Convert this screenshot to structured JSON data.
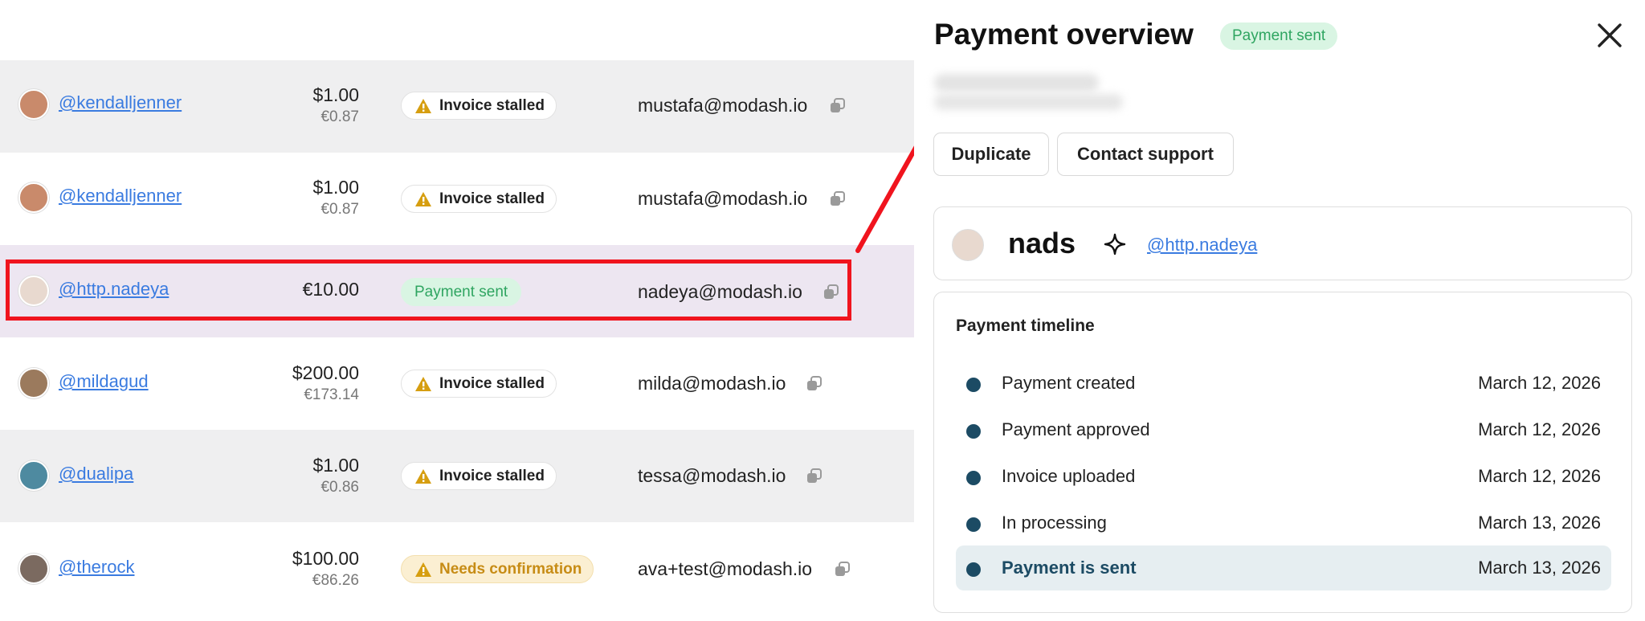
{
  "table": {
    "rows": [
      {
        "handle": "@kendalljenner",
        "amount": "$1.00",
        "amount_sub": "€0.87",
        "status": "Invoice stalled",
        "status_kind": "stalled",
        "email": "mustafa@modash.io",
        "avatar_color": "#c98a6b"
      },
      {
        "handle": "@kendalljenner",
        "amount": "$1.00",
        "amount_sub": "€0.87",
        "status": "Invoice stalled",
        "status_kind": "stalled",
        "email": "mustafa@modash.io",
        "avatar_color": "#c98a6b"
      },
      {
        "handle": "@http.nadeya",
        "amount": "€10.00",
        "amount_sub": "",
        "status": "Payment sent",
        "status_kind": "sent",
        "email": "nadeya@modash.io",
        "avatar_color": "#e8d9cf",
        "selected": true
      },
      {
        "handle": "@mildagud",
        "amount": "$200.00",
        "amount_sub": "€173.14",
        "status": "Invoice stalled",
        "status_kind": "stalled",
        "email": "milda@modash.io",
        "avatar_color": "#9b7a5d"
      },
      {
        "handle": "@dualipa",
        "amount": "$1.00",
        "amount_sub": "€0.86",
        "status": "Invoice stalled",
        "status_kind": "stalled",
        "email": "tessa@modash.io",
        "avatar_color": "#4e8aa0"
      },
      {
        "handle": "@therock",
        "amount": "$100.00",
        "amount_sub": "€86.26",
        "status": "Needs confirmation",
        "status_kind": "confirm",
        "email": "ava+test@modash.io",
        "avatar_color": "#7b6a60"
      }
    ]
  },
  "panel": {
    "title": "Payment overview",
    "badge": "Payment sent",
    "buttons": {
      "duplicate": "Duplicate",
      "support": "Contact support"
    },
    "profile": {
      "name": "nads",
      "handle": "@http.nadeya"
    },
    "timeline": {
      "title": "Payment timeline",
      "items": [
        {
          "label": "Payment created",
          "date": "March 12, 2026"
        },
        {
          "label": "Payment approved",
          "date": "March 12, 2026"
        },
        {
          "label": "Invoice uploaded",
          "date": "March 12, 2026"
        },
        {
          "label": "In processing",
          "date": "March 13, 2026"
        },
        {
          "label": "Payment is sent",
          "date": "March 13, 2026",
          "active": true
        }
      ]
    }
  },
  "colors": {
    "link": "#3a7be0",
    "success_bg": "#d9f5e3",
    "success_text": "#2fa561",
    "warning": "#d69e10",
    "highlight": "#f0141e",
    "timeline_dot": "#1c4b64"
  },
  "icons": [
    "warning-icon",
    "copy-icon",
    "close-icon",
    "sparkle-icon"
  ]
}
